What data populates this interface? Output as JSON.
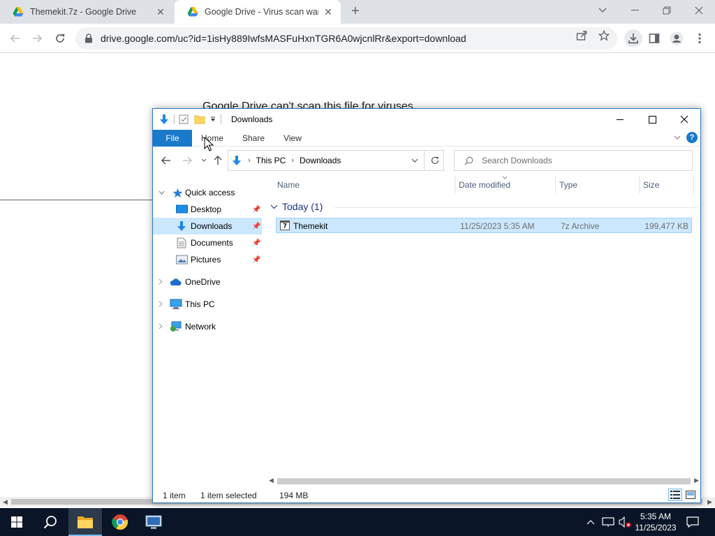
{
  "browser": {
    "tabs": [
      {
        "title": "Themekit.7z - Google Drive"
      },
      {
        "title": "Google Drive - Virus scan warnin"
      }
    ],
    "url": "drive.google.com/uc?id=1isHy889IwfsMASFuHxnTGR6A0wjcnlRr&export=download"
  },
  "page": {
    "heading": "Google Drive can't scan this file for viruses."
  },
  "explorer": {
    "title": "Downloads",
    "ribbon_tabs": [
      "File",
      "Home",
      "Share",
      "View"
    ],
    "breadcrumb": [
      "This PC",
      "Downloads"
    ],
    "search_placeholder": "Search Downloads",
    "nav": {
      "quick_access": "Quick access",
      "desktop": "Desktop",
      "downloads": "Downloads",
      "documents": "Documents",
      "pictures": "Pictures",
      "onedrive": "OneDrive",
      "thispc": "This PC",
      "network": "Network"
    },
    "columns": {
      "name": "Name",
      "date": "Date modified",
      "type": "Type",
      "size": "Size"
    },
    "group": "Today (1)",
    "file": {
      "name": "Themekit",
      "date": "11/25/2023 5:35 AM",
      "type": "7z Archive",
      "size": "199,477 KB"
    },
    "status": {
      "count": "1 item",
      "selected": "1 item selected",
      "size": "194 MB"
    }
  },
  "taskbar": {
    "time": "5:35 AM",
    "date": "11/25/2023"
  },
  "colors": {
    "accent": "#1979ca",
    "selection": "#cce8ff",
    "taskbar": "#0a1628"
  }
}
